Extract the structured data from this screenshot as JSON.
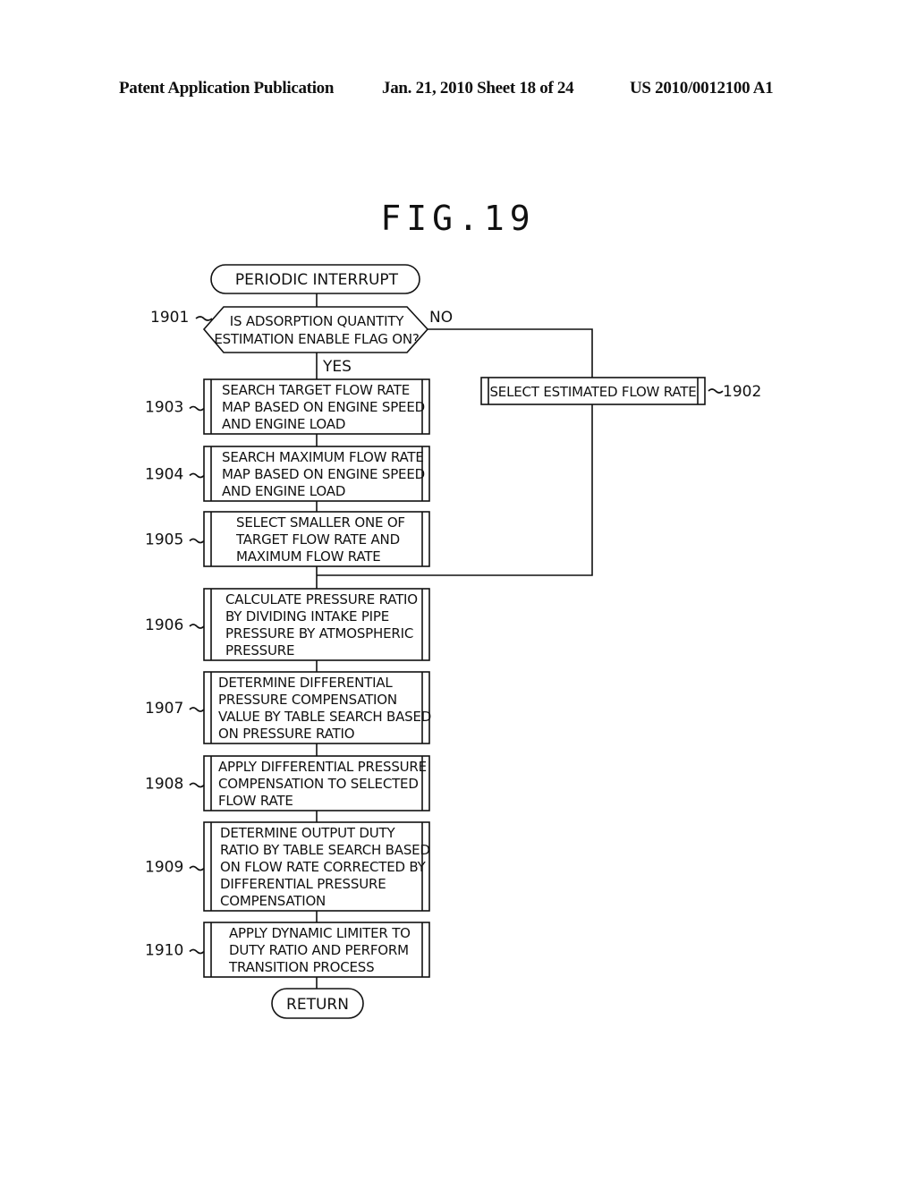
{
  "header": {
    "publication": "Patent Application Publication",
    "date_sheet": "Jan. 21, 2010  Sheet 18 of 24",
    "patent_number": "US 2010/0012100 A1"
  },
  "figure": {
    "title": "FIG.19"
  },
  "flowchart": {
    "start": "PERIODIC INTERRUPT",
    "end": "RETURN",
    "decision": {
      "ref": "1901",
      "lines": [
        "IS ADSORPTION QUANTITY",
        "ESTIMATION ENABLE FLAG ON?"
      ],
      "yes_label": "YES",
      "no_label": "NO"
    },
    "no_branch": {
      "ref": "1902",
      "lines": [
        "SELECT ESTIMATED FLOW RATE"
      ]
    },
    "steps": [
      {
        "ref": "1903",
        "lines": [
          "SEARCH TARGET FLOW RATE",
          "MAP BASED ON ENGINE SPEED",
          "AND ENGINE LOAD"
        ]
      },
      {
        "ref": "1904",
        "lines": [
          "SEARCH MAXIMUM FLOW RATE",
          "MAP BASED ON ENGINE SPEED",
          "AND ENGINE LOAD"
        ]
      },
      {
        "ref": "1905",
        "lines": [
          "SELECT SMALLER ONE OF",
          "TARGET FLOW RATE AND",
          "MAXIMUM FLOW RATE"
        ]
      },
      {
        "ref": "1906",
        "lines": [
          "CALCULATE PRESSURE RATIO",
          "BY DIVIDING INTAKE PIPE",
          "PRESSURE BY ATMOSPHERIC",
          "PRESSURE"
        ]
      },
      {
        "ref": "1907",
        "lines": [
          "DETERMINE DIFFERENTIAL",
          "PRESSURE COMPENSATION",
          "VALUE BY TABLE SEARCH BASED",
          "ON PRESSURE RATIO"
        ]
      },
      {
        "ref": "1908",
        "lines": [
          "APPLY DIFFERENTIAL PRESSURE",
          "COMPENSATION TO SELECTED",
          "FLOW RATE"
        ]
      },
      {
        "ref": "1909",
        "lines": [
          "DETERMINE OUTPUT DUTY",
          "RATIO BY TABLE SEARCH BASED",
          "ON FLOW RATE CORRECTED BY",
          "DIFFERENTIAL PRESSURE",
          "COMPENSATION"
        ]
      },
      {
        "ref": "1910",
        "lines": [
          "APPLY DYNAMIC LIMITER TO",
          "DUTY RATIO AND PERFORM",
          "TRANSITION PROCESS"
        ]
      }
    ]
  }
}
